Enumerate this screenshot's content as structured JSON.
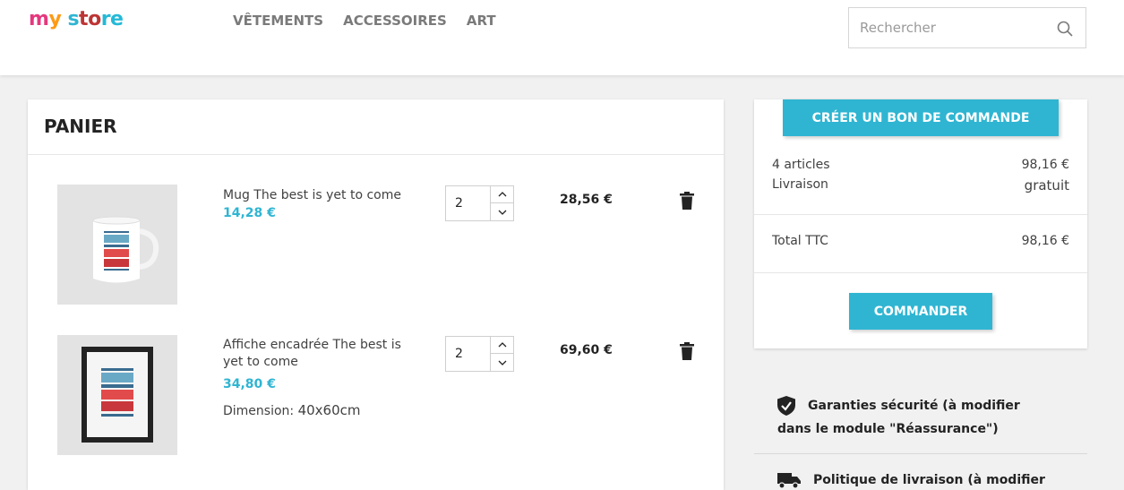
{
  "header": {
    "logo": {
      "part1": "m",
      "part2": "y",
      "part3": " s",
      "part4": "to",
      "part5": "re"
    },
    "nav": [
      "VÊTEMENTS",
      "ACCESSOIRES",
      "ART"
    ],
    "search": {
      "placeholder": "Rechercher",
      "icon": "search-icon"
    }
  },
  "cart": {
    "title": "PANIER",
    "lines": [
      {
        "name": "Mug The best is yet to come",
        "unit_price": "14,28 €",
        "quantity": "2",
        "total": "28,56 €",
        "image": "mug-image"
      },
      {
        "name": "Affiche encadrée The best is yet to come",
        "unit_price": "34,80 €",
        "attribute_label": "Dimension:",
        "attribute_value": "40x60cm",
        "quantity": "2",
        "total": "69,60 €",
        "image": "framed-poster-image"
      }
    ]
  },
  "summary": {
    "quote_button": "CRÉER UN BON DE COMMANDE",
    "articles_label": "4 articles",
    "articles_value": "98,16 €",
    "shipping_label": "Livraison",
    "shipping_value": "gratuit",
    "total_label": "Total TTC",
    "total_value": "98,16 €",
    "checkout_button": "COMMANDER"
  },
  "reassurance": [
    {
      "icon": "shield-check-icon",
      "text_line1": "Garanties sécurité (à modifier",
      "text_line2": "dans le module \"Réassurance\")"
    },
    {
      "icon": "truck-icon",
      "text_line1": "Politique de livraison (à modifier"
    }
  ],
  "colors": {
    "accent": "#2fb5d2",
    "text": "#232323",
    "background": "#f1f1f1"
  }
}
